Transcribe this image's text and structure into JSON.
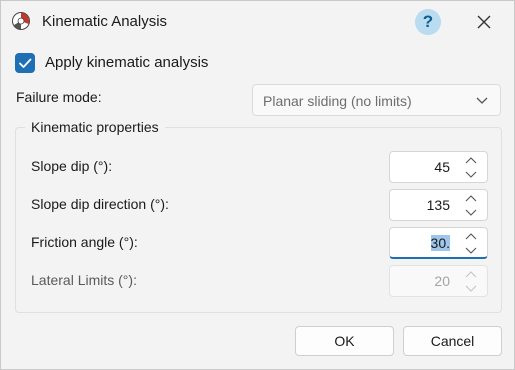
{
  "window": {
    "title": "Kinematic Analysis"
  },
  "titlebar": {
    "help_label": "?"
  },
  "apply": {
    "label": "Apply kinematic analysis",
    "checked": true
  },
  "failure_mode": {
    "label": "Failure mode:",
    "value": "Planar sliding (no limits)"
  },
  "group": {
    "title": "Kinematic properties"
  },
  "fields": {
    "slope_dip": {
      "label": "Slope dip (°):",
      "value": "45"
    },
    "slope_dip_direction": {
      "label": "Slope dip direction (°):",
      "value": "135"
    },
    "friction_angle": {
      "label": "Friction angle (°):",
      "value": "30."
    },
    "lateral_limits": {
      "label": "Lateral Limits (°):",
      "value": "20"
    }
  },
  "buttons": {
    "ok": "OK",
    "cancel": "Cancel"
  },
  "colors": {
    "accent": "#1f6fb4",
    "help_bg": "#b9dcf0",
    "app_icon_red": "#c0392b"
  }
}
